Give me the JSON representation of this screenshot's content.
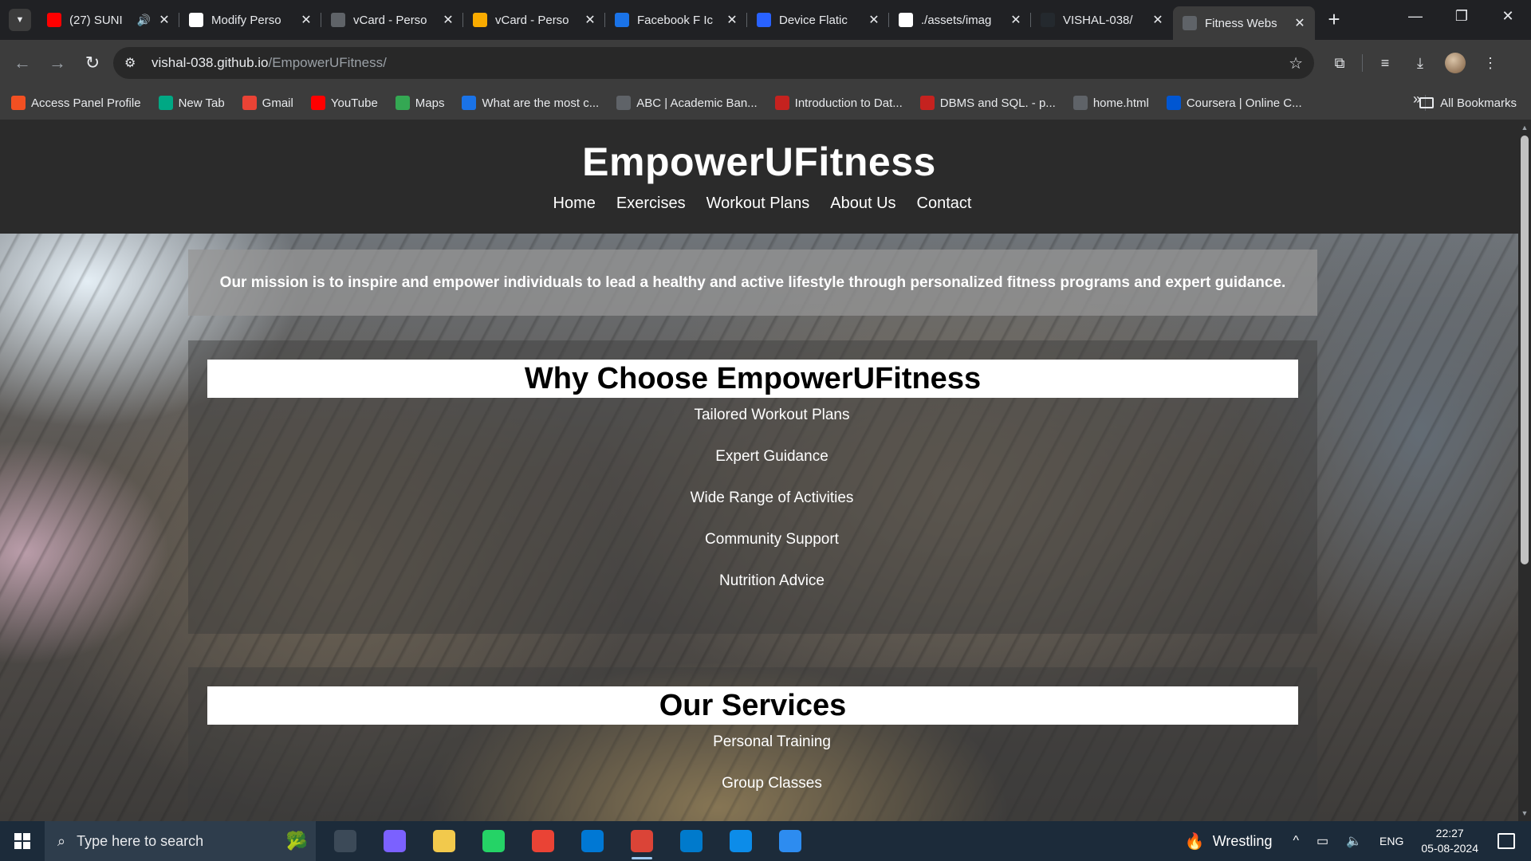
{
  "browser": {
    "tabs": [
      {
        "title": "(27) SUNI",
        "icon": "youtube-icon",
        "icon_color": "#ff0000",
        "audio": true
      },
      {
        "title": "Modify Perso",
        "icon": "openai-icon",
        "icon_color": "#ffffff"
      },
      {
        "title": "vCard - Perso",
        "icon": "globe-icon",
        "icon_color": "#5f6368"
      },
      {
        "title": "vCard - Perso",
        "icon": "pen-icon",
        "icon_color": "#f9ab00"
      },
      {
        "title": "Facebook F Ic",
        "icon": "flag-icon",
        "icon_color": "#1a73e8"
      },
      {
        "title": "Device Flatic",
        "icon": "flaticon-icon",
        "icon_color": "#2962ff"
      },
      {
        "title": "./assets/imag",
        "icon": "google-icon",
        "icon_color": "#ffffff"
      },
      {
        "title": "VISHAL-038/",
        "icon": "github-icon",
        "icon_color": "#24292e"
      },
      {
        "title": "Fitness Webs",
        "icon": "globe-icon",
        "icon_color": "#5f6368",
        "active": true
      }
    ],
    "url_host": "vishal-038.github.io",
    "url_path": "/EmpowerUFitness/",
    "bookmarks": [
      {
        "label": "Access Panel Profile",
        "icon": "microsoft-icon",
        "color": "#f25022"
      },
      {
        "label": "New Tab",
        "icon": "m-icon",
        "color": "#00a884"
      },
      {
        "label": "Gmail",
        "icon": "gmail-icon",
        "color": "#ea4335"
      },
      {
        "label": "YouTube",
        "icon": "youtube-icon",
        "color": "#ff0000"
      },
      {
        "label": "Maps",
        "icon": "maps-icon",
        "color": "#34a853"
      },
      {
        "label": "What are the most c...",
        "icon": "quora-icon",
        "color": "#1a73e8"
      },
      {
        "label": "ABC | Academic Ban...",
        "icon": "globe-icon",
        "color": "#5f6368"
      },
      {
        "label": "Introduction to Dat...",
        "icon": "slides-icon",
        "color": "#c5221f"
      },
      {
        "label": "DBMS and SQL. - p...",
        "icon": "slides-icon",
        "color": "#c5221f"
      },
      {
        "label": "home.html",
        "icon": "globe-icon",
        "color": "#5f6368"
      },
      {
        "label": "Coursera | Online C...",
        "icon": "coursera-icon",
        "color": "#0056d2"
      }
    ],
    "all_bookmarks": "All Bookmarks"
  },
  "site": {
    "title": "EmpowerUFitness",
    "nav": [
      "Home",
      "Exercises",
      "Workout Plans",
      "About Us",
      "Contact"
    ],
    "mission": "Our mission is to inspire and empower individuals to lead a healthy and active lifestyle through personalized fitness programs and expert guidance.",
    "why": {
      "heading": "Why Choose EmpowerUFitness",
      "items": [
        "Tailored Workout Plans",
        "Expert Guidance",
        "Wide Range of Activities",
        "Community Support",
        "Nutrition Advice"
      ]
    },
    "services": {
      "heading": "Our Services",
      "items": [
        "Personal Training",
        "Group Classes"
      ]
    }
  },
  "taskbar": {
    "search_placeholder": "Type here to search",
    "apps": [
      {
        "name": "task-view-icon",
        "color": "#3c4a58"
      },
      {
        "name": "copilot-icon",
        "color": "#7b61ff"
      },
      {
        "name": "file-explorer-icon",
        "color": "#f2c94c"
      },
      {
        "name": "whatsapp-icon",
        "color": "#25d366"
      },
      {
        "name": "chrome-icon",
        "color": "#ea4335"
      },
      {
        "name": "microsoft-store-icon",
        "color": "#0078d4"
      },
      {
        "name": "chrome-profile-icon",
        "color": "#db4437",
        "active": true
      },
      {
        "name": "vscode-icon",
        "color": "#007acc"
      },
      {
        "name": "edge-icon",
        "color": "#0c8ce9"
      },
      {
        "name": "photos-icon",
        "color": "#2d8cf0"
      }
    ],
    "weather": "Wrestling",
    "language": "ENG",
    "time": "22:27",
    "date": "05-08-2024"
  }
}
